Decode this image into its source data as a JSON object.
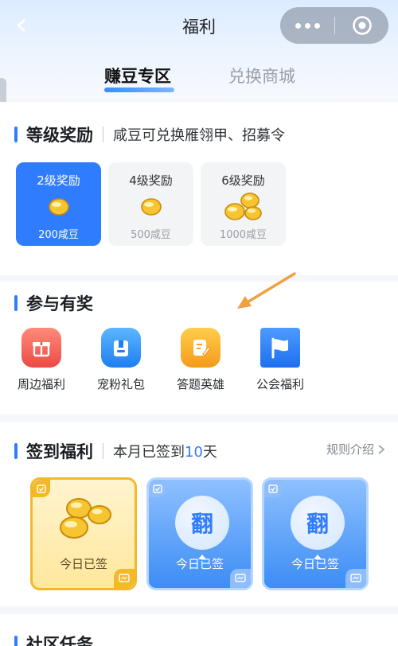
{
  "header": {
    "title": "福利",
    "back_icon": "arrow-left-icon",
    "more_icon": "more-dots-icon",
    "close_icon": "target-circle-icon"
  },
  "tabs": [
    {
      "label": "赚豆专区",
      "active": true
    },
    {
      "label": "兑换商城",
      "active": false
    }
  ],
  "level_section": {
    "title": "等级奖励",
    "desc": "咸豆可兑换雁翎甲、招募令",
    "levels": [
      {
        "title": "2级奖励",
        "amount": "200咸豆",
        "active": true,
        "beans": 1
      },
      {
        "title": "4级奖励",
        "amount": "500咸豆",
        "active": false,
        "beans": 1
      },
      {
        "title": "6级奖励",
        "amount": "1000咸豆",
        "active": false,
        "beans": 3
      }
    ]
  },
  "participate_section": {
    "title": "参与有奖",
    "entries": [
      {
        "label": "周边福利",
        "icon": "gift-icon",
        "color": "#f0504a"
      },
      {
        "label": "宠粉礼包",
        "icon": "giftbag-icon",
        "color": "#2f8cf5"
      },
      {
        "label": "答题英雄",
        "icon": "edit-note-icon",
        "color": "#f5a623"
      },
      {
        "label": "公会福利",
        "icon": "flag-icon",
        "color": "#2f7cff"
      }
    ]
  },
  "checkin_section": {
    "title": "签到福利",
    "desc_prefix": "本月已签到",
    "desc_days": "10",
    "desc_suffix": "天",
    "rule_link": "规则介绍",
    "days": [
      {
        "status": "今日已签",
        "style": "gold"
      },
      {
        "status": "今日已签",
        "style": "blue",
        "flip": "翻"
      },
      {
        "status": "今日已签",
        "style": "blue",
        "flip": "翻"
      }
    ]
  },
  "community_section": {
    "title": "社区任务"
  },
  "colors": {
    "accent": "#2f7cff",
    "annotation_arrow": "#f0a040"
  }
}
